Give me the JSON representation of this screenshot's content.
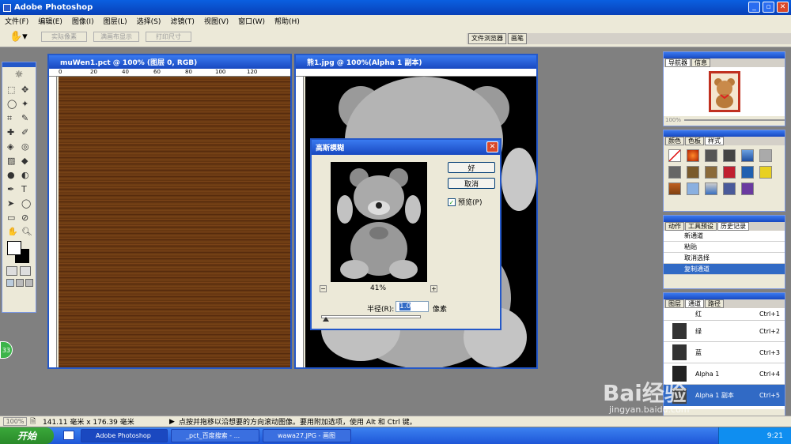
{
  "app": {
    "title": "Adobe Photoshop"
  },
  "menu": [
    "文件(F)",
    "编辑(E)",
    "图像(I)",
    "图层(L)",
    "选择(S)",
    "滤镜(T)",
    "视图(V)",
    "窗口(W)",
    "帮助(H)"
  ],
  "options": {
    "btn1": "实际像素",
    "btn2": "满画布显示",
    "btn3": "打印尺寸"
  },
  "well_tabs": [
    "文件浏览器",
    "画笔"
  ],
  "doc1": {
    "title": "muWen1.pct @ 100% (图层 0, RGB)"
  },
  "doc2": {
    "title": "熊1.jpg @ 100%(Alpha 1 副本)"
  },
  "ruler_marks": [
    "0",
    "20",
    "40",
    "60",
    "80",
    "100",
    "120"
  ],
  "dialog": {
    "title": "高斯模糊",
    "ok": "好",
    "cancel": "取消",
    "preview_label": "预览(P)",
    "preview_checked": true,
    "zoom": "41%",
    "radius_label": "半径(R):",
    "radius_value": "1.0",
    "radius_unit": "像素"
  },
  "navigator": {
    "tabs": [
      "导航器",
      "信息"
    ],
    "zoom": "100%"
  },
  "color_panel": {
    "tabs": [
      "颜色",
      "色板",
      "样式"
    ]
  },
  "history": {
    "tabs": [
      "动作",
      "工具预设",
      "历史记录"
    ],
    "items": [
      "新通道",
      "粘贴",
      "取消选择",
      "复制通道"
    ]
  },
  "channels": {
    "tabs": [
      "图层",
      "通道",
      "路径"
    ],
    "items": [
      {
        "name": "红",
        "shortcut": "Ctrl+1"
      },
      {
        "name": "绿",
        "shortcut": "Ctrl+2"
      },
      {
        "name": "蓝",
        "shortcut": "Ctrl+3"
      },
      {
        "name": "Alpha 1",
        "shortcut": "Ctrl+4"
      },
      {
        "name": "Alpha 1 副本",
        "shortcut": "Ctrl+5"
      }
    ]
  },
  "status": {
    "zoom": "100%",
    "size": "141.11 毫米 x 176.39 毫米",
    "hint": "点按并拖移以沿想要的方向滚动图像。要用附加选项，使用 Alt 和 Ctrl 键。"
  },
  "taskbar": {
    "start": "开始",
    "tasks": [
      "Adobe Photoshop",
      "_pct_百度搜索 - ...",
      "wawa27.JPG - 画图"
    ],
    "clock": "9:21"
  },
  "badge": "33",
  "watermark": {
    "brand": "Bai经验",
    "url": "jingyan.baidu.com"
  },
  "colors": {
    "xp_blue": "#0a5fe0",
    "wood": "#6b3a12",
    "dialog_face": "#ece9d8"
  }
}
